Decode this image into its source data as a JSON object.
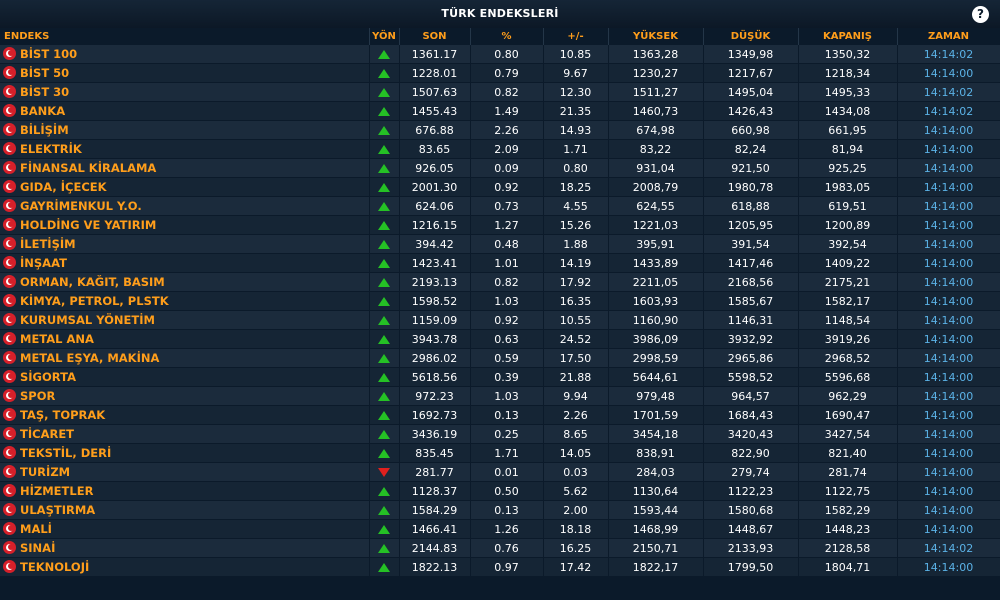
{
  "header": {
    "title": "TÜRK ENDEKSLERİ",
    "help_icon": "?"
  },
  "columns": [
    "ENDEKS",
    "YÖN",
    "SON",
    "%",
    "+/-",
    "YÜKSEK",
    "DÜŞÜK",
    "KAPANIŞ",
    "ZAMAN"
  ],
  "colors": {
    "accent": "#ff9e1b",
    "up": "#25c125",
    "down": "#e0201e",
    "time": "#5bb2e6"
  },
  "rows": [
    {
      "name": "BİST 100",
      "dir": "up",
      "son": "1361.17",
      "pct": "0.80",
      "chg": "10.85",
      "high": "1363,28",
      "low": "1349,98",
      "close": "1350,32",
      "time": "14:14:02"
    },
    {
      "name": "BİST 50",
      "dir": "up",
      "son": "1228.01",
      "pct": "0.79",
      "chg": "9.67",
      "high": "1230,27",
      "low": "1217,67",
      "close": "1218,34",
      "time": "14:14:00"
    },
    {
      "name": "BİST 30",
      "dir": "up",
      "son": "1507.63",
      "pct": "0.82",
      "chg": "12.30",
      "high": "1511,27",
      "low": "1495,04",
      "close": "1495,33",
      "time": "14:14:02"
    },
    {
      "name": "BANKA",
      "dir": "up",
      "son": "1455.43",
      "pct": "1.49",
      "chg": "21.35",
      "high": "1460,73",
      "low": "1426,43",
      "close": "1434,08",
      "time": "14:14:02"
    },
    {
      "name": "BİLİŞİM",
      "dir": "up",
      "son": "676.88",
      "pct": "2.26",
      "chg": "14.93",
      "high": "674,98",
      "low": "660,98",
      "close": "661,95",
      "time": "14:14:00"
    },
    {
      "name": "ELEKTRİK",
      "dir": "up",
      "son": "83.65",
      "pct": "2.09",
      "chg": "1.71",
      "high": "83,22",
      "low": "82,24",
      "close": "81,94",
      "time": "14:14:00"
    },
    {
      "name": "FİNANSAL KİRALAMA",
      "dir": "up",
      "son": "926.05",
      "pct": "0.09",
      "chg": "0.80",
      "high": "931,04",
      "low": "921,50",
      "close": "925,25",
      "time": "14:14:00"
    },
    {
      "name": "GIDA, İÇECEK",
      "dir": "up",
      "son": "2001.30",
      "pct": "0.92",
      "chg": "18.25",
      "high": "2008,79",
      "low": "1980,78",
      "close": "1983,05",
      "time": "14:14:00"
    },
    {
      "name": "GAYRİMENKUL Y.O.",
      "dir": "up",
      "son": "624.06",
      "pct": "0.73",
      "chg": "4.55",
      "high": "624,55",
      "low": "618,88",
      "close": "619,51",
      "time": "14:14:00"
    },
    {
      "name": "HOLDİNG VE YATIRIM",
      "dir": "up",
      "son": "1216.15",
      "pct": "1.27",
      "chg": "15.26",
      "high": "1221,03",
      "low": "1205,95",
      "close": "1200,89",
      "time": "14:14:00"
    },
    {
      "name": "İLETİŞİM",
      "dir": "up",
      "son": "394.42",
      "pct": "0.48",
      "chg": "1.88",
      "high": "395,91",
      "low": "391,54",
      "close": "392,54",
      "time": "14:14:00"
    },
    {
      "name": "İNŞAAT",
      "dir": "up",
      "son": "1423.41",
      "pct": "1.01",
      "chg": "14.19",
      "high": "1433,89",
      "low": "1417,46",
      "close": "1409,22",
      "time": "14:14:00"
    },
    {
      "name": "ORMAN, KAĞIT, BASIM",
      "dir": "up",
      "son": "2193.13",
      "pct": "0.82",
      "chg": "17.92",
      "high": "2211,05",
      "low": "2168,56",
      "close": "2175,21",
      "time": "14:14:00"
    },
    {
      "name": "KİMYA, PETROL, PLSTK",
      "dir": "up",
      "son": "1598.52",
      "pct": "1.03",
      "chg": "16.35",
      "high": "1603,93",
      "low": "1585,67",
      "close": "1582,17",
      "time": "14:14:00"
    },
    {
      "name": "KURUMSAL YÖNETİM",
      "dir": "up",
      "son": "1159.09",
      "pct": "0.92",
      "chg": "10.55",
      "high": "1160,90",
      "low": "1146,31",
      "close": "1148,54",
      "time": "14:14:00"
    },
    {
      "name": "METAL ANA",
      "dir": "up",
      "son": "3943.78",
      "pct": "0.63",
      "chg": "24.52",
      "high": "3986,09",
      "low": "3932,92",
      "close": "3919,26",
      "time": "14:14:00"
    },
    {
      "name": "METAL EŞYA, MAKİNA",
      "dir": "up",
      "son": "2986.02",
      "pct": "0.59",
      "chg": "17.50",
      "high": "2998,59",
      "low": "2965,86",
      "close": "2968,52",
      "time": "14:14:00"
    },
    {
      "name": "SİGORTA",
      "dir": "up",
      "son": "5618.56",
      "pct": "0.39",
      "chg": "21.88",
      "high": "5644,61",
      "low": "5598,52",
      "close": "5596,68",
      "time": "14:14:00"
    },
    {
      "name": "SPOR",
      "dir": "up",
      "son": "972.23",
      "pct": "1.03",
      "chg": "9.94",
      "high": "979,48",
      "low": "964,57",
      "close": "962,29",
      "time": "14:14:00"
    },
    {
      "name": "TAŞ, TOPRAK",
      "dir": "up",
      "son": "1692.73",
      "pct": "0.13",
      "chg": "2.26",
      "high": "1701,59",
      "low": "1684,43",
      "close": "1690,47",
      "time": "14:14:00"
    },
    {
      "name": "TİCARET",
      "dir": "up",
      "son": "3436.19",
      "pct": "0.25",
      "chg": "8.65",
      "high": "3454,18",
      "low": "3420,43",
      "close": "3427,54",
      "time": "14:14:00"
    },
    {
      "name": "TEKSTİL, DERİ",
      "dir": "up",
      "son": "835.45",
      "pct": "1.71",
      "chg": "14.05",
      "high": "838,91",
      "low": "822,90",
      "close": "821,40",
      "time": "14:14:00"
    },
    {
      "name": "TURİZM",
      "dir": "down",
      "son": "281.77",
      "pct": "0.01",
      "chg": "0.03",
      "high": "284,03",
      "low": "279,74",
      "close": "281,74",
      "time": "14:14:00"
    },
    {
      "name": "HİZMETLER",
      "dir": "up",
      "son": "1128.37",
      "pct": "0.50",
      "chg": "5.62",
      "high": "1130,64",
      "low": "1122,23",
      "close": "1122,75",
      "time": "14:14:00"
    },
    {
      "name": "ULAŞTIRMA",
      "dir": "up",
      "son": "1584.29",
      "pct": "0.13",
      "chg": "2.00",
      "high": "1593,44",
      "low": "1580,68",
      "close": "1582,29",
      "time": "14:14:00"
    },
    {
      "name": "MALİ",
      "dir": "up",
      "son": "1466.41",
      "pct": "1.26",
      "chg": "18.18",
      "high": "1468,99",
      "low": "1448,67",
      "close": "1448,23",
      "time": "14:14:00"
    },
    {
      "name": "SINAİ",
      "dir": "up",
      "son": "2144.83",
      "pct": "0.76",
      "chg": "16.25",
      "high": "2150,71",
      "low": "2133,93",
      "close": "2128,58",
      "time": "14:14:02"
    },
    {
      "name": "TEKNOLOJİ",
      "dir": "up",
      "son": "1822.13",
      "pct": "0.97",
      "chg": "17.42",
      "high": "1822,17",
      "low": "1799,50",
      "close": "1804,71",
      "time": "14:14:00"
    }
  ]
}
